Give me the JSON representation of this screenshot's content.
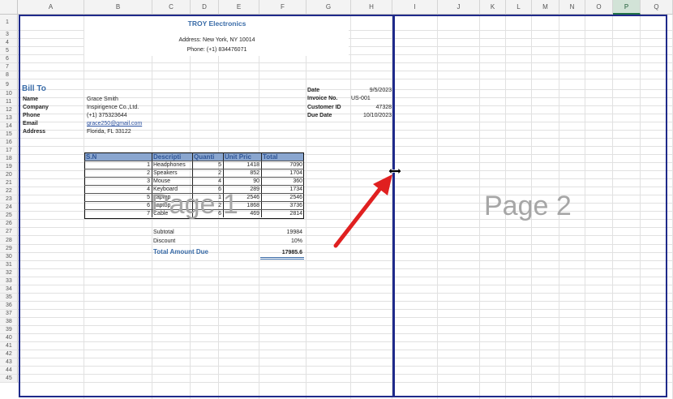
{
  "columns": [
    "A",
    "B",
    "C",
    "D",
    "E",
    "F",
    "G",
    "H",
    "I",
    "J",
    "K",
    "L",
    "M",
    "N",
    "O",
    "P",
    "Q"
  ],
  "selected_column": "P",
  "rows": [
    "1",
    "3",
    "4",
    "5",
    "6",
    "7",
    "8",
    "9",
    "10",
    "11",
    "12",
    "13",
    "14",
    "15",
    "16",
    "17",
    "18",
    "19",
    "20",
    "21",
    "22",
    "23",
    "24",
    "25",
    "26",
    "27",
    "28",
    "29",
    "30",
    "31",
    "32",
    "33",
    "34",
    "35",
    "36",
    "37",
    "38",
    "39",
    "40",
    "41",
    "42",
    "43",
    "44",
    "45"
  ],
  "company": {
    "name": "TROY Electronics",
    "address": "Address: New York, NY 10014",
    "phone": "Phone: (+1) 834476071"
  },
  "bill_to": {
    "title": "Bill To",
    "labels": [
      "Name",
      "Company",
      "Phone",
      "Email",
      "Address"
    ],
    "values": [
      "Grace Smith",
      "Inspirigence Co.,Ltd.",
      "(+1) 375323644",
      "grace250@gmail.com",
      "Florida, FL 33122"
    ]
  },
  "invoice_info": {
    "labels": [
      "Date",
      "Invoice No.",
      "Customer ID",
      "Due Date"
    ],
    "values": [
      "9/5/2023",
      "US-001",
      "47328",
      "10/10/2023"
    ]
  },
  "table": {
    "headers": [
      "S.N",
      "Descripti",
      "Quanti",
      "Unit Pric",
      "Total"
    ],
    "rows": [
      [
        "1",
        "Headphones",
        "5",
        "1418",
        "7090"
      ],
      [
        "2",
        "Speakers",
        "2",
        "852",
        "1704"
      ],
      [
        "3",
        "Mouse",
        "4",
        "90",
        "360"
      ],
      [
        "4",
        "Keyboard",
        "6",
        "289",
        "1734"
      ],
      [
        "5",
        "Laptop",
        "1",
        "2546",
        "2546"
      ],
      [
        "6",
        "Laptop",
        "2",
        "1868",
        "3736"
      ],
      [
        "7",
        "Cable",
        "6",
        "469",
        "2814"
      ]
    ]
  },
  "totals": {
    "subtotal_label": "Subtotal",
    "subtotal_value": "19984",
    "discount_label": "Discount",
    "discount_value": "10%",
    "total_label": "Total Amount Due",
    "total_value": "17985.6"
  },
  "watermarks": {
    "page1": "Page 1",
    "page2": "Page 2"
  },
  "colors": {
    "page_break": "#1f2a8a",
    "table_header": "#8aa6cf",
    "accent_blue": "#3a6ca8",
    "arrow": "#e02020"
  },
  "icons": [
    "resize-cursor-icon",
    "red-arrow-icon"
  ]
}
